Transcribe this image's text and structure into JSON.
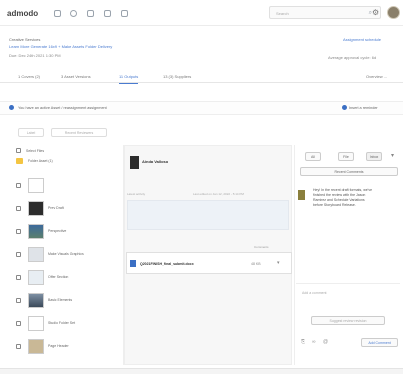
{
  "app": {
    "logo": "admodo"
  },
  "topbar": {
    "nav_icons": [
      "home-icon",
      "grid-icon",
      "chart-icon",
      "calendar-icon",
      "inbox-icon"
    ],
    "search_placeholder": "Search",
    "search_icon": "search-icon",
    "settings_icon": "gear-icon"
  },
  "header": {
    "title": "Creative Services",
    "link": "Learn More Generate 16x9 + Make Assets Folder Delivery",
    "meta": "Due: Dec 24th 2021 1:30 PM",
    "right_link": "Assignment schedule",
    "right_meta": "Average approval cycle: 6d"
  },
  "tabs": [
    {
      "label": "1 Covers (2)"
    },
    {
      "label": "3 Asset Versions"
    },
    {
      "label": "11 Outputs"
    },
    {
      "label": "13 (3) Suppliers"
    }
  ],
  "tabs_right": "Overview ...",
  "alert": {
    "text": "You have an active Asset / reassignment assignment",
    "right_label": "Insert a reminder"
  },
  "filters": {
    "pill1": "Label",
    "pill2": "Recent Reviewers"
  },
  "list": {
    "header": "Select Files",
    "rows": [
      {
        "label": "Folder Asset (1)"
      },
      {
        "label": ""
      },
      {
        "label": "Prev Draft"
      },
      {
        "label": "Perspective"
      },
      {
        "label": "Make Visuals Graphics"
      },
      {
        "label": "Offer Section"
      },
      {
        "label": "Basic Elements"
      },
      {
        "label": "Studio Folder Set"
      },
      {
        "label": "Page Header"
      }
    ]
  },
  "panel": {
    "owner": "Ainda Valloso",
    "note_left": "Latest activity",
    "note_right": "Last edited on Jan 12, 2022 - 5:14 PM",
    "attach_label": "Comments",
    "file_name": "Q2021FINISH_final_submit.docx",
    "file_size": "48 KB"
  },
  "rpanel": {
    "tabs": [
      "All",
      "File",
      "Inbox"
    ],
    "recent_label": "Recent Comments",
    "comment": "Hey! In the recent draft formats, we've finished the review with the Jason Ramirez and Schedule Variations before Storyboard Release.",
    "input_placeholder": "Add a comment",
    "secondary_btn": "Suggest review revision",
    "send_btn": "Add Comment"
  },
  "colors": {
    "accent": "#4a7bd0",
    "brand_dot": "#3b6fc4"
  }
}
